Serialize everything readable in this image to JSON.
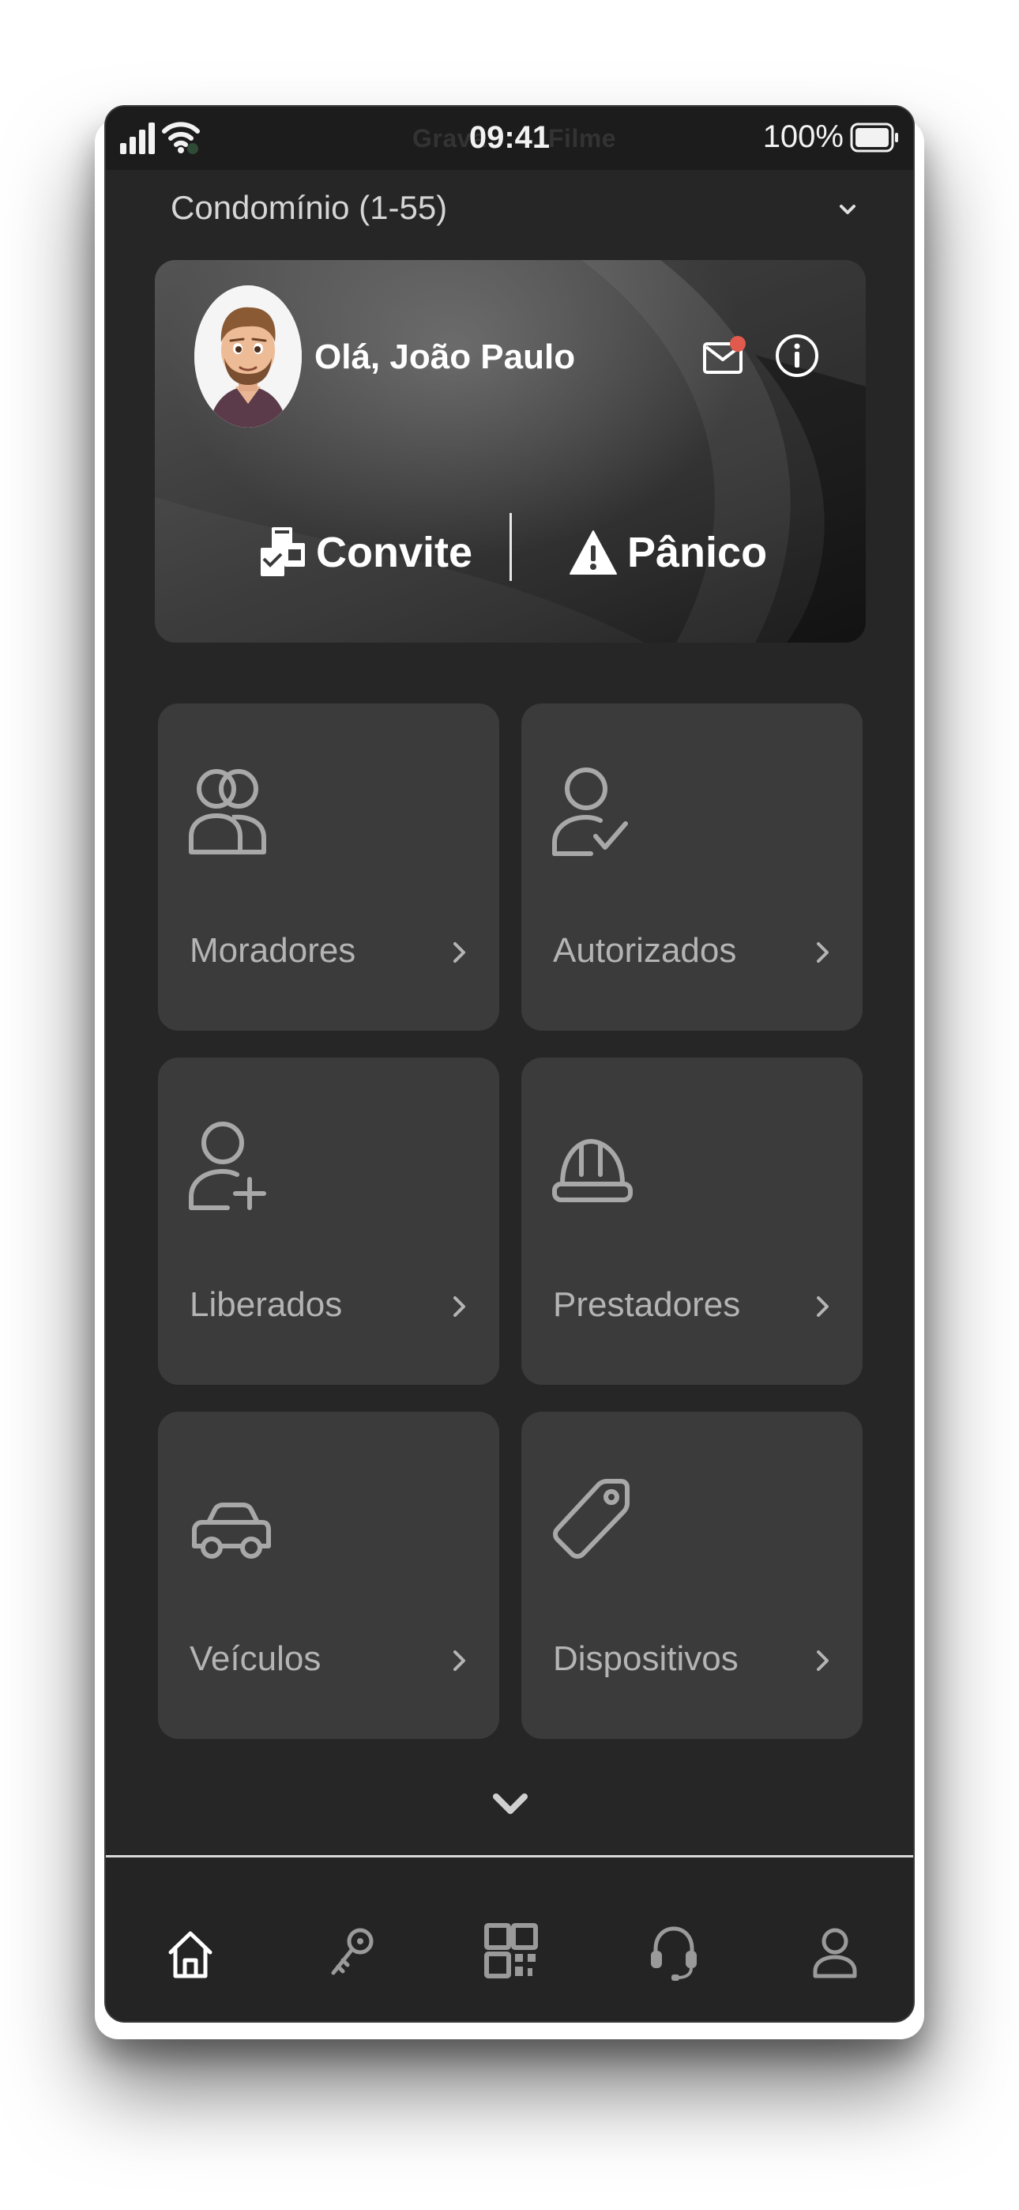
{
  "status_bar": {
    "time": "09:41",
    "recording_ghost_left": "Grava",
    "recording_ghost_right": "Filme",
    "battery": "100%"
  },
  "header": {
    "condominium_selector": "Condomínio (1-55)"
  },
  "hero": {
    "greeting": "Olá, João Paulo",
    "invite_label": "Convite",
    "panic_label": "Pânico",
    "mail_has_notification": true,
    "notification_color": "#e05a4e"
  },
  "tiles": [
    {
      "label": "Moradores",
      "icon": "users-icon"
    },
    {
      "label": "Autorizados",
      "icon": "user-check-icon"
    },
    {
      "label": "Liberados",
      "icon": "user-plus-icon"
    },
    {
      "label": "Prestadores",
      "icon": "hardhat-icon"
    },
    {
      "label": "Veículos",
      "icon": "car-icon"
    },
    {
      "label": "Dispositivos",
      "icon": "tag-icon"
    }
  ],
  "bottom_nav": [
    {
      "name": "home",
      "icon": "home-icon",
      "active": true
    },
    {
      "name": "key",
      "icon": "key-icon",
      "active": false
    },
    {
      "name": "qr",
      "icon": "qr-code-icon",
      "active": false
    },
    {
      "name": "support",
      "icon": "headset-icon",
      "active": false
    },
    {
      "name": "profile",
      "icon": "user-icon",
      "active": false
    }
  ],
  "colors": {
    "background": "#262626",
    "tile": "#3b3b3b",
    "tile_text": "#b4b4b4",
    "active_nav": "#ffffff",
    "inactive_nav": "#9a9a9a"
  }
}
